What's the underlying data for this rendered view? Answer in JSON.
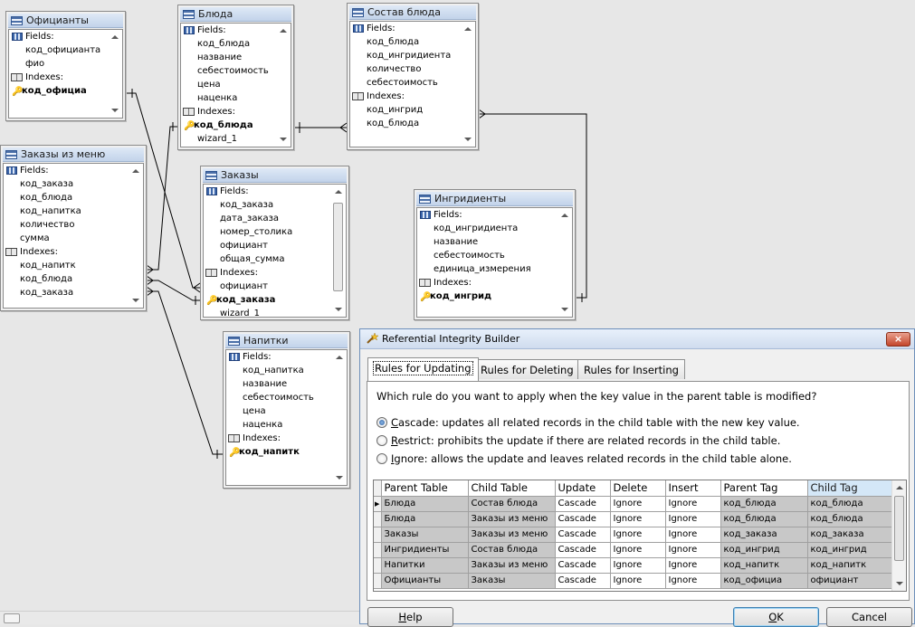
{
  "tables": {
    "oficianty": {
      "title": "Официанты",
      "rows": [
        {
          "kind": "hdr",
          "icon": "grid",
          "text": "Fields:"
        },
        {
          "kind": "fld",
          "text": "код_официанта"
        },
        {
          "kind": "fld",
          "text": "фио"
        },
        {
          "kind": "hdr",
          "icon": "book",
          "text": "Indexes:"
        },
        {
          "kind": "key",
          "text": "код_официа"
        }
      ]
    },
    "bluda": {
      "title": "Блюда",
      "rows": [
        {
          "kind": "hdr",
          "icon": "grid",
          "text": "Fields:"
        },
        {
          "kind": "fld",
          "text": "код_блюда"
        },
        {
          "kind": "fld",
          "text": "название"
        },
        {
          "kind": "fld",
          "text": "себестоимость"
        },
        {
          "kind": "fld",
          "text": "цена"
        },
        {
          "kind": "fld",
          "text": "наценка"
        },
        {
          "kind": "hdr",
          "icon": "book",
          "text": "Indexes:"
        },
        {
          "kind": "key",
          "text": "код_блюда"
        },
        {
          "kind": "fld",
          "text": "wizard_1"
        }
      ]
    },
    "sostav": {
      "title": "Состав блюда",
      "rows": [
        {
          "kind": "hdr",
          "icon": "grid",
          "text": "Fields:"
        },
        {
          "kind": "fld",
          "text": "код_блюда"
        },
        {
          "kind": "fld",
          "text": "код_ингридиента"
        },
        {
          "kind": "fld",
          "text": "количество"
        },
        {
          "kind": "fld",
          "text": "себестоимость"
        },
        {
          "kind": "hdr",
          "icon": "book",
          "text": "Indexes:"
        },
        {
          "kind": "fld",
          "text": "код_ингрид"
        },
        {
          "kind": "fld",
          "text": "код_блюда"
        }
      ]
    },
    "zakazy_menu": {
      "title": "Заказы из меню",
      "rows": [
        {
          "kind": "hdr",
          "icon": "grid",
          "text": "Fields:"
        },
        {
          "kind": "fld",
          "text": "код_заказа"
        },
        {
          "kind": "fld",
          "text": "код_блюда"
        },
        {
          "kind": "fld",
          "text": "код_напитка"
        },
        {
          "kind": "fld",
          "text": "количество"
        },
        {
          "kind": "fld",
          "text": "сумма"
        },
        {
          "kind": "hdr",
          "icon": "book",
          "text": "Indexes:"
        },
        {
          "kind": "fld",
          "text": "код_напитк"
        },
        {
          "kind": "fld",
          "text": "код_блюда"
        },
        {
          "kind": "fld",
          "text": "код_заказа"
        }
      ]
    },
    "zakazy": {
      "title": "Заказы",
      "rows": [
        {
          "kind": "hdr",
          "icon": "grid",
          "text": "Fields:"
        },
        {
          "kind": "fld",
          "text": "код_заказа"
        },
        {
          "kind": "fld",
          "text": "дата_заказа"
        },
        {
          "kind": "fld",
          "text": "номер_столика"
        },
        {
          "kind": "fld",
          "text": "официант"
        },
        {
          "kind": "fld",
          "text": "общая_сумма"
        },
        {
          "kind": "hdr",
          "icon": "book",
          "text": "Indexes:"
        },
        {
          "kind": "fld",
          "text": "официант"
        },
        {
          "kind": "key",
          "text": "код_заказа"
        },
        {
          "kind": "fld",
          "text": "wizard_1"
        }
      ]
    },
    "ingridienty": {
      "title": "Ингридиенты",
      "rows": [
        {
          "kind": "hdr",
          "icon": "grid",
          "text": "Fields:"
        },
        {
          "kind": "fld",
          "text": "код_ингридиента"
        },
        {
          "kind": "fld",
          "text": "название"
        },
        {
          "kind": "fld",
          "text": "себестоимость"
        },
        {
          "kind": "fld",
          "text": "единица_измерения"
        },
        {
          "kind": "hdr",
          "icon": "book",
          "text": "Indexes:"
        },
        {
          "kind": "key",
          "text": "код_ингрид"
        }
      ]
    },
    "napitki": {
      "title": "Напитки",
      "rows": [
        {
          "kind": "hdr",
          "icon": "grid",
          "text": "Fields:"
        },
        {
          "kind": "fld",
          "text": "код_напитка"
        },
        {
          "kind": "fld",
          "text": "название"
        },
        {
          "kind": "fld",
          "text": "себестоимость"
        },
        {
          "kind": "fld",
          "text": "цена"
        },
        {
          "kind": "fld",
          "text": "наценка"
        },
        {
          "kind": "hdr",
          "icon": "book",
          "text": "Indexes:"
        },
        {
          "kind": "key",
          "text": "код_напитк"
        }
      ]
    }
  },
  "dialog": {
    "title": "Referential Integrity Builder",
    "close_label": "×",
    "tabs": [
      "Rules for Updating",
      "Rules for Deleting",
      "Rules for Inserting"
    ],
    "question": "Which rule do you want to apply when the key value in the parent table is modified?",
    "options": {
      "cascade": {
        "hotkey": "C",
        "rest": "ascade: updates all related records in the child table with the new key value."
      },
      "restrict": {
        "hotkey": "R",
        "rest": "estrict: prohibits the update if there are related records in the child table."
      },
      "ignore": {
        "hotkey": "I",
        "rest": "gnore: allows the update and leaves related records in the child table alone."
      }
    },
    "grid": {
      "columns": [
        "Parent Table",
        "Child Table",
        "Update",
        "Delete",
        "Insert",
        "Parent Tag",
        "Child Tag"
      ],
      "rows": [
        [
          "Блюда",
          "Состав блюда",
          "Cascade",
          "Ignore",
          "Ignore",
          "код_блюда",
          "код_блюда"
        ],
        [
          "Блюда",
          "Заказы из меню",
          "Cascade",
          "Ignore",
          "Ignore",
          "код_блюда",
          "код_блюда"
        ],
        [
          "Заказы",
          "Заказы из меню",
          "Cascade",
          "Ignore",
          "Ignore",
          "код_заказа",
          "код_заказа"
        ],
        [
          "Ингридиенты",
          "Состав блюда",
          "Cascade",
          "Ignore",
          "Ignore",
          "код_ингрид",
          "код_ингрид"
        ],
        [
          "Напитки",
          "Заказы из меню",
          "Cascade",
          "Ignore",
          "Ignore",
          "код_напитк",
          "код_напитк"
        ],
        [
          "Официанты",
          "Заказы",
          "Cascade",
          "Ignore",
          "Ignore",
          "код_официа",
          "официант"
        ]
      ]
    },
    "buttons": {
      "help_hotkey": "H",
      "help_rest": "elp",
      "ok_hotkey": "O",
      "ok_rest": "K",
      "cancel": "Cancel"
    }
  }
}
